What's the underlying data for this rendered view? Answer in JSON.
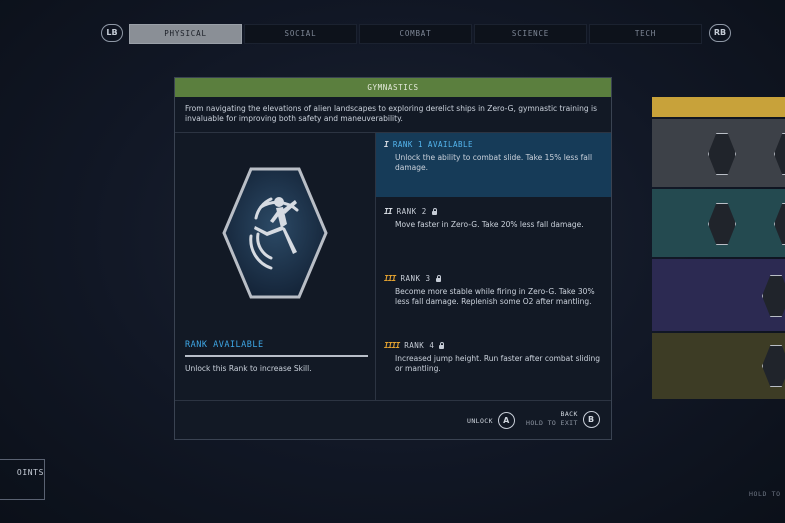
{
  "nav": {
    "lb": "LB",
    "rb": "RB",
    "tabs": [
      "PHYSICAL",
      "SOCIAL",
      "COMBAT",
      "SCIENCE",
      "TECH"
    ],
    "active_tab": "PHYSICAL"
  },
  "skill": {
    "title": "GYMNASTICS",
    "description": "From navigating the elevations of alien landscapes to exploring derelict ships in Zero-G, gymnastic training is invaluable for improving both safety and maneuverability.",
    "badge_icon": "acrobat-kick-icon",
    "status": "RANK AVAILABLE",
    "hint": "Unlock this Rank to increase Skill."
  },
  "ranks": [
    {
      "label": "RANK 1 AVAILABLE",
      "bars": "I",
      "locked": false,
      "text": "Unlock the ability to combat slide. Take 15% less fall damage."
    },
    {
      "label": "RANK 2",
      "bars": "II",
      "locked": true,
      "text": "Move faster in Zero-G. Take 20% less fall damage."
    },
    {
      "label": "RANK 3",
      "bars": "III",
      "locked": true,
      "text": "Become more stable while firing in Zero-G. Take 30% less fall damage. Replenish some O2 after mantling."
    },
    {
      "label": "RANK 4",
      "bars": "IIII",
      "locked": true,
      "text": "Increased jump height. Run faster after combat sliding or mantling."
    }
  ],
  "footer": {
    "unlock_label": "UNLOCK",
    "unlock_key": "A",
    "back_label": "BACK",
    "back_sub": "HOLD TO EXIT",
    "back_key": "B"
  },
  "side": {
    "points_label": "OINTS",
    "hold_to": "HOLD TO"
  },
  "colors": {
    "title_bar": "#5b7f3e",
    "rank_available": "#3ea7e6",
    "rank_highlight_bg": "#163b58",
    "rank_bar_gold": "#e0a030"
  }
}
